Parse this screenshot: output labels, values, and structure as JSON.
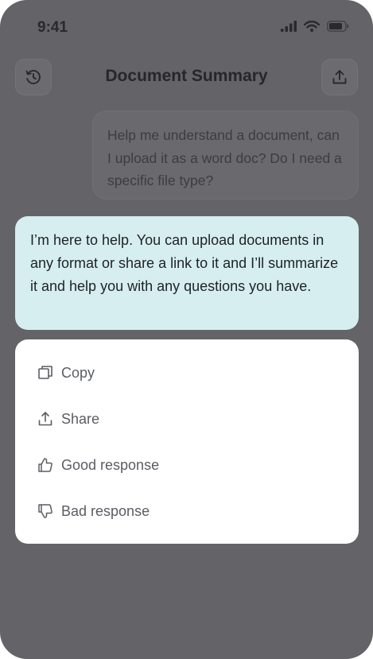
{
  "status_bar": {
    "time": "9:41"
  },
  "header": {
    "title": "Document Summary",
    "history_icon": "clock-history-icon",
    "upload_icon": "upload-icon"
  },
  "chat": {
    "user_message": "Help me understand a document, can I upload it as a word doc? Do I need a specific file type?",
    "assistant_message": "I’m here to help. You can upload documents in any format or share a link to it and I’ll summarize it and help you with any questions you have."
  },
  "context_menu": {
    "items": [
      {
        "label": "Copy",
        "icon": "copy-icon"
      },
      {
        "label": "Share",
        "icon": "share-icon"
      },
      {
        "label": "Good response",
        "icon": "thumbs-up-icon"
      },
      {
        "label": "Bad response",
        "icon": "thumbs-down-icon"
      }
    ]
  },
  "colors": {
    "overlay": "#636368",
    "assistant_bubble": "#d6eeef",
    "menu_bg": "#ffffff"
  }
}
